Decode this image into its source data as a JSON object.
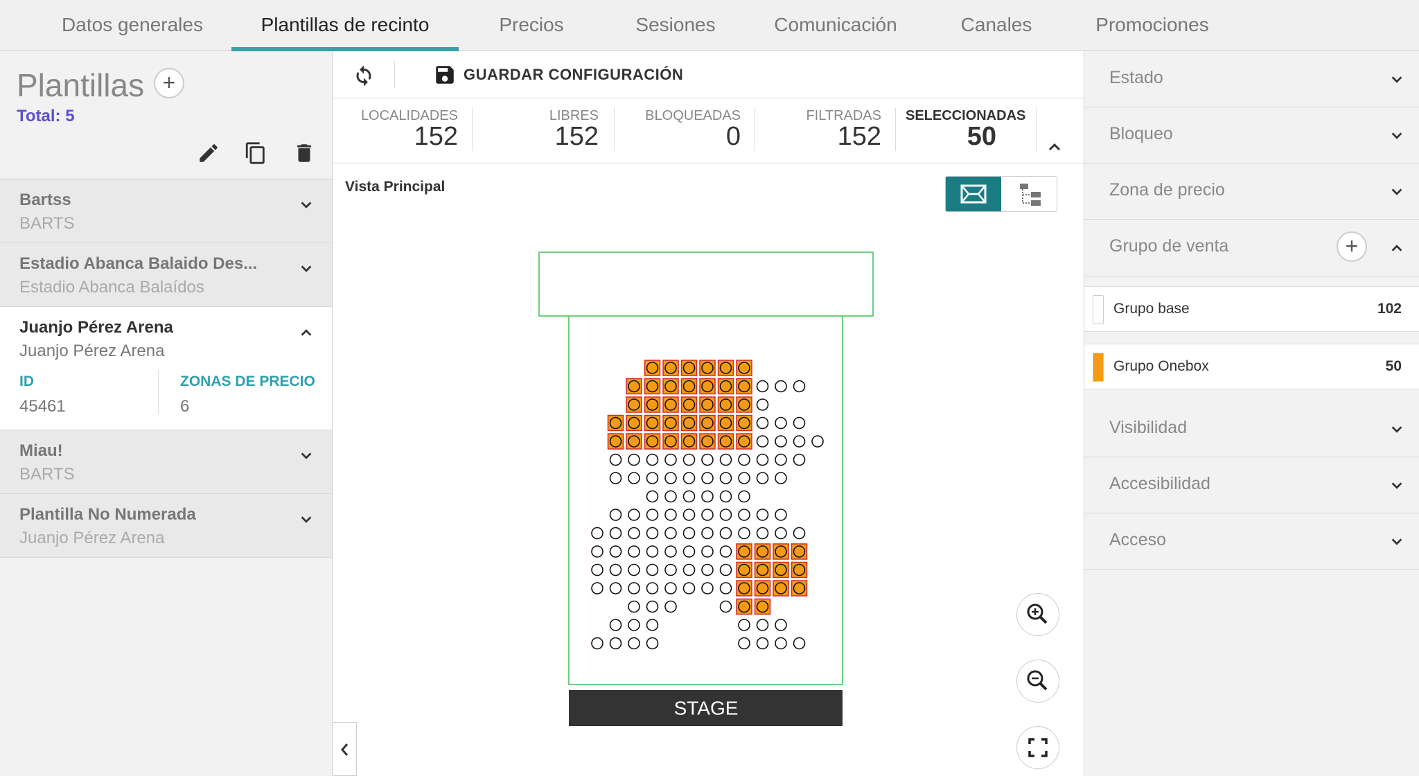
{
  "tabs": [
    {
      "label": "Datos generales",
      "active": false
    },
    {
      "label": "Plantillas de recinto",
      "active": true
    },
    {
      "label": "Precios",
      "active": false
    },
    {
      "label": "Sesiones",
      "active": false
    },
    {
      "label": "Comunicación",
      "active": false
    },
    {
      "label": "Canales",
      "active": false
    },
    {
      "label": "Promociones",
      "active": false
    }
  ],
  "left": {
    "title": "Plantillas",
    "add_label": "+",
    "total": "Total: 5",
    "items": [
      {
        "title": "Bartss",
        "subtitle": "BARTS",
        "expanded": false
      },
      {
        "title": "Estadio Abanca Balaido Des...",
        "subtitle": "Estadio Abanca Balaídos",
        "expanded": false
      },
      {
        "title": "Juanjo Pérez Arena",
        "subtitle": "Juanjo Pérez Arena",
        "expanded": true,
        "id_label": "ID",
        "id_value": "45461",
        "zones_label": "ZONAS DE PRECIO",
        "zones_value": "6"
      },
      {
        "title": "Miau!",
        "subtitle": "BARTS",
        "expanded": false
      },
      {
        "title": "Plantilla No Numerada",
        "subtitle": "Juanjo Pérez Arena",
        "expanded": false
      }
    ]
  },
  "center": {
    "save_label": "GUARDAR CONFIGURACIÓN",
    "counters": [
      {
        "label": "LOCALIDADES",
        "value": "152"
      },
      {
        "label": "LIBRES",
        "value": "152"
      },
      {
        "label": "BLOQUEADAS",
        "value": "0"
      },
      {
        "label": "FILTRADAS",
        "value": "152"
      },
      {
        "label": "SELECCIONADAS",
        "value": "50"
      }
    ],
    "view_title": "Vista Principal",
    "stage_label": "STAGE",
    "seat_rows": [
      {
        "start": 6,
        "count": 6,
        "selected": [
          0,
          1,
          2,
          3,
          4,
          5
        ]
      },
      {
        "start": 5,
        "count": 10,
        "selected": [
          0,
          1,
          2,
          3,
          4,
          5,
          6
        ]
      },
      {
        "start": 5,
        "count": 8,
        "selected": [
          0,
          1,
          2,
          3,
          4,
          5,
          6
        ]
      },
      {
        "start": 4,
        "count": 11,
        "selected": [
          0,
          1,
          2,
          3,
          4,
          5,
          6,
          7
        ]
      },
      {
        "start": 4,
        "count": 12,
        "selected": [
          0,
          1,
          2,
          3,
          4,
          5,
          6,
          7
        ]
      },
      {
        "start": 4,
        "count": 11,
        "selected": []
      },
      {
        "start": 4,
        "count": 10,
        "selected": []
      },
      {
        "start": 6,
        "count": 6,
        "selected": []
      },
      {
        "start": 4,
        "count": 10,
        "selected": []
      },
      {
        "start": 3,
        "count": 12,
        "selected": []
      },
      {
        "start": 3,
        "count": 12,
        "selected": [
          8,
          9,
          10,
          11
        ]
      },
      {
        "start": 3,
        "count": 12,
        "selected": [
          8,
          9,
          10,
          11
        ]
      },
      {
        "start": 3,
        "count": 12,
        "selected": [
          8,
          9,
          10,
          11
        ]
      },
      {
        "segments": [
          {
            "start": 5,
            "count": 3
          },
          {
            "start": 10,
            "count": 3
          }
        ],
        "selected_cols": [
          11,
          12
        ]
      },
      {
        "segments": [
          {
            "start": 4,
            "count": 3
          },
          {
            "start": 11,
            "count": 3
          }
        ],
        "selected_cols": []
      },
      {
        "segments": [
          {
            "start": 3,
            "count": 4
          },
          {
            "start": 11,
            "count": 4
          }
        ],
        "selected_cols": []
      }
    ],
    "colors": {
      "selected_fill": "#f59a16",
      "selected_border": "#d42a2a",
      "accent": "#1c7c84",
      "zone_border": "#6ccf7e",
      "stage_bg": "#333333"
    }
  },
  "right": {
    "accordions_top": [
      "Estado",
      "Bloqueo",
      "Zona de precio"
    ],
    "sales_group_label": "Grupo de venta",
    "groups": [
      {
        "name": "Grupo base",
        "count": "102",
        "color": "#ffffff"
      },
      {
        "name": "Grupo Onebox",
        "count": "50",
        "color": "#f59a16"
      }
    ],
    "accordions_bottom": [
      "Visibilidad",
      "Accesibilidad",
      "Acceso"
    ]
  }
}
